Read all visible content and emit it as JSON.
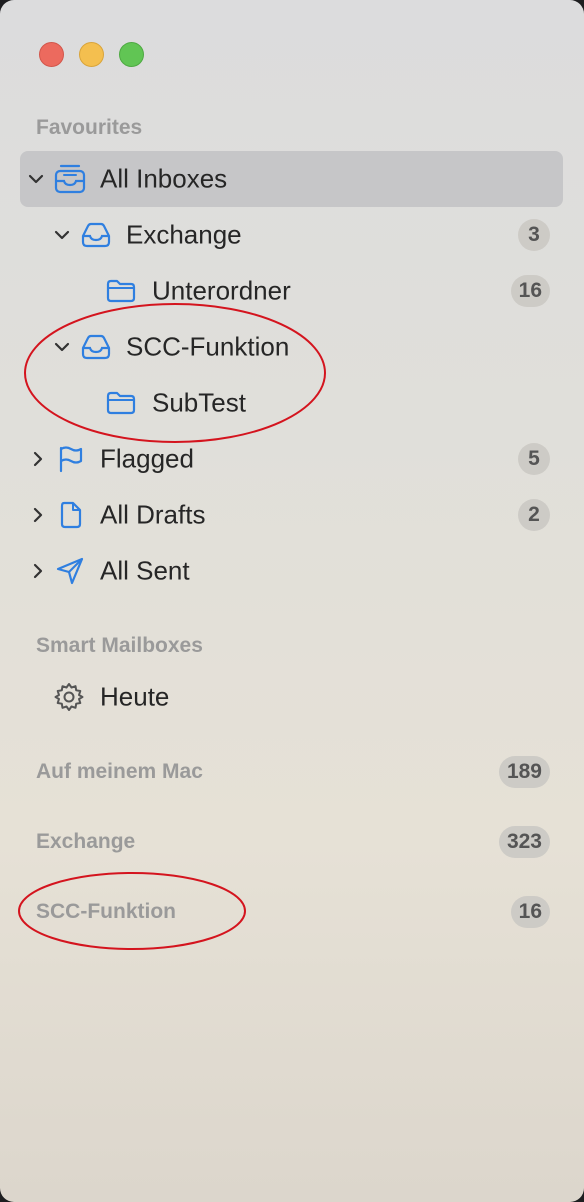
{
  "sidebar": {
    "sections": {
      "favourites": "Favourites",
      "smart_mailboxes": "Smart Mailboxes"
    },
    "favourites": {
      "all_inboxes": {
        "label": "All Inboxes"
      },
      "exchange": {
        "label": "Exchange",
        "count": "3"
      },
      "unterordner": {
        "label": "Unterordner",
        "count": "16"
      },
      "scc_funktion": {
        "label": "SCC-Funktion"
      },
      "subtest": {
        "label": "SubTest"
      },
      "flagged": {
        "label": "Flagged",
        "count": "5"
      },
      "all_drafts": {
        "label": "All Drafts",
        "count": "2"
      },
      "all_sent": {
        "label": "All Sent"
      }
    },
    "smart": {
      "heute": {
        "label": "Heute"
      }
    },
    "accounts": [
      {
        "label": "Auf meinem Mac",
        "count": "189"
      },
      {
        "label": "Exchange",
        "count": "323"
      },
      {
        "label": "SCC-Funktion",
        "count": "16"
      }
    ]
  },
  "colors": {
    "accent_icon": "#2f7fe0",
    "annotation": "#d4141e"
  },
  "icons": {
    "inbox": "inbox-tray-icon",
    "folder": "folder-icon",
    "flag": "flag-icon",
    "draft": "document-icon",
    "sent": "paper-plane-icon",
    "smart": "gear-icon"
  }
}
